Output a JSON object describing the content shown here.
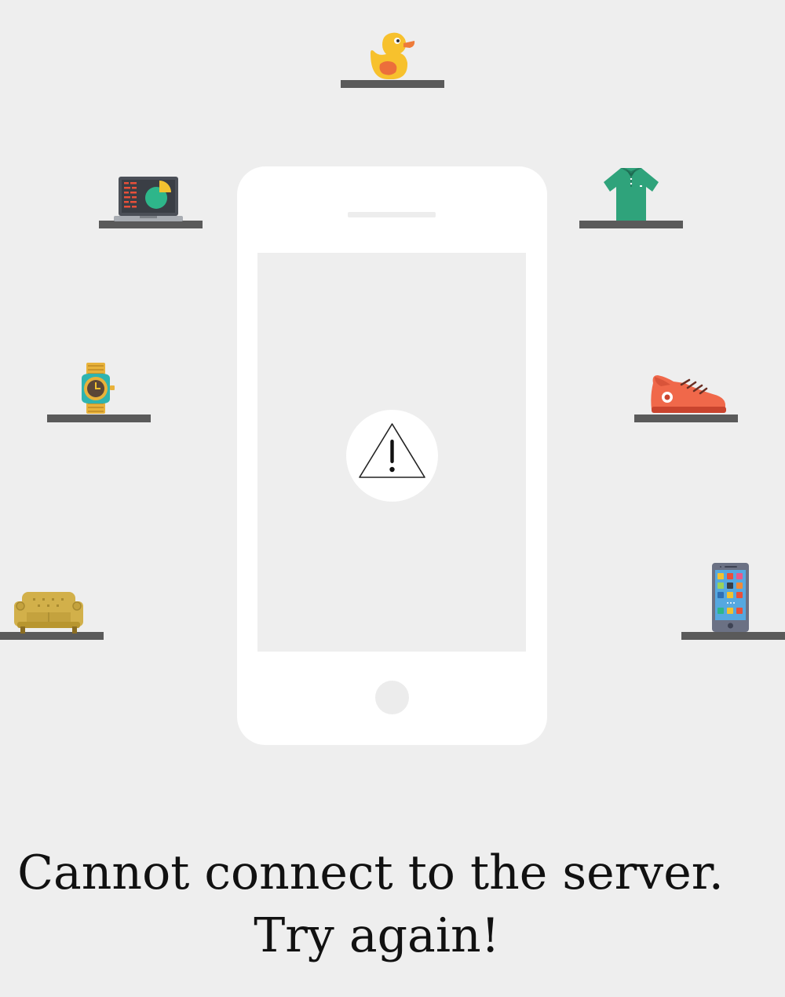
{
  "message": {
    "line1": "Cannot connect to the server.",
    "line2": "Try again!"
  },
  "icons": {
    "center": "warning-icon",
    "shelf_items": [
      "rubber-duck-icon",
      "laptop-icon",
      "polo-shirt-icon",
      "wristwatch-icon",
      "sneaker-icon",
      "armchair-icon",
      "smartphone-icon"
    ]
  },
  "colors": {
    "background": "#eeeeee",
    "shelf": "#5a5a5a",
    "phone": "#ffffff"
  }
}
